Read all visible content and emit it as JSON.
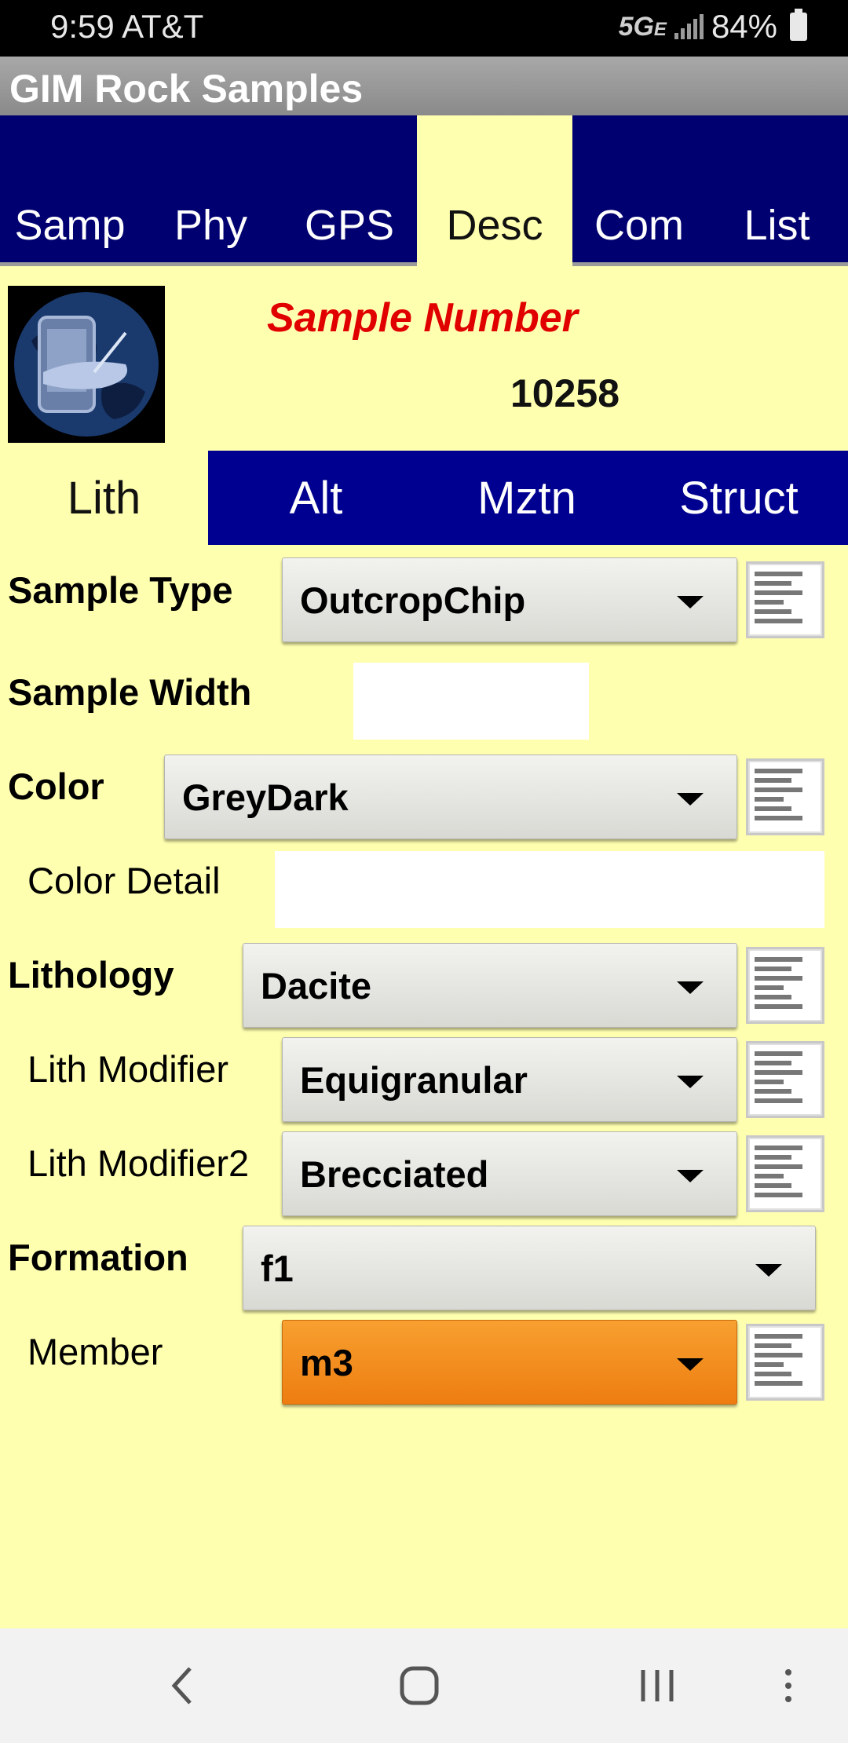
{
  "status_bar": {
    "time": "9:59",
    "carrier": "AT&T",
    "network": "5G",
    "network_sub": "E",
    "battery": "84%"
  },
  "app": {
    "title": "GIM Rock Samples"
  },
  "top_tabs": [
    {
      "label": "Samp",
      "active": false
    },
    {
      "label": "Phy",
      "active": false
    },
    {
      "label": "GPS",
      "active": false
    },
    {
      "label": "Desc",
      "active": true
    },
    {
      "label": "Com",
      "active": false
    },
    {
      "label": "List",
      "active": false
    }
  ],
  "header": {
    "sample_number_label": "Sample Number",
    "sample_number": "10258"
  },
  "sub_tabs": [
    {
      "label": "Lith",
      "active": true
    },
    {
      "label": "Alt",
      "active": false
    },
    {
      "label": "Mztn",
      "active": false
    },
    {
      "label": "Struct",
      "active": false
    }
  ],
  "form": {
    "sample_type": {
      "label": "Sample Type",
      "value": "OutcropChip"
    },
    "sample_width": {
      "label": "Sample Width",
      "value": ""
    },
    "color": {
      "label": "Color",
      "value": "GreyDark"
    },
    "color_detail": {
      "label": "Color Detail",
      "value": ""
    },
    "lithology": {
      "label": "Lithology",
      "value": "Dacite"
    },
    "lith_modifier": {
      "label": "Lith Modifier",
      "value": "Equigranular"
    },
    "lith_modifier2": {
      "label": "Lith Modifier2",
      "value": "Brecciated"
    },
    "formation": {
      "label": "Formation",
      "value": "f1"
    },
    "member": {
      "label": "Member",
      "value": "m3"
    }
  },
  "colors": {
    "background": "#ffffb0",
    "tab_bar": "#000070",
    "sub_tab_bar": "#000090",
    "sample_number_label": "#e10000",
    "member_dropdown": "#ee7d10"
  },
  "icons": [
    "notes-icon",
    "logo-globe-hand-icon",
    "back-icon",
    "home-icon",
    "recents-icon",
    "more-icon",
    "signal-icon",
    "battery-icon"
  ]
}
